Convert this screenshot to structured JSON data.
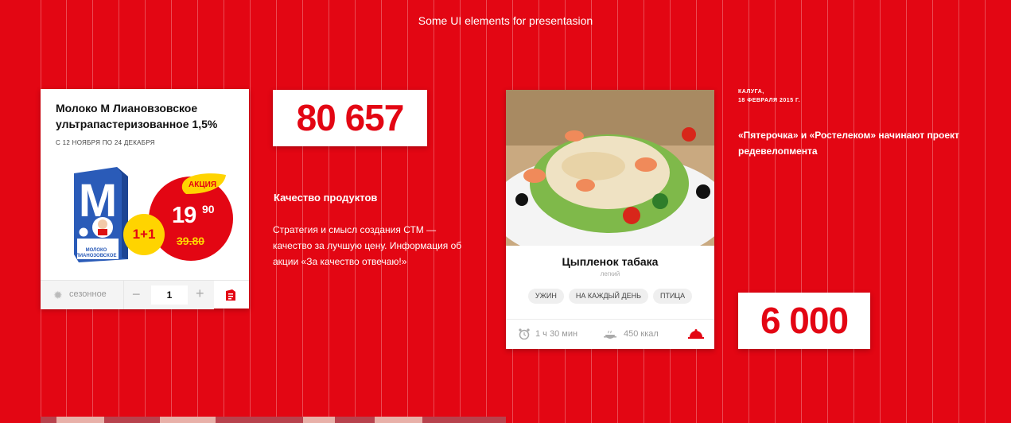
{
  "page": {
    "title": "Some UI elements for presentasion"
  },
  "product_card": {
    "name": "Молоко М Лиановзовское ультрапастеризованное 1,5%",
    "dates": "С 12 НОЯБРЯ ПО 24 ДЕКАБРЯ",
    "pack_brand": "М",
    "pack_label": "МОЛОКО ЛИАНОЗОВСКОЕ",
    "promo_label": "АКЦИЯ",
    "price_main": "19",
    "price_cents": "90",
    "price_old": "39.80",
    "badge": "1+1",
    "season_label": "сезонное",
    "minus": "−",
    "quantity": "1",
    "plus": "+"
  },
  "stat_top": {
    "value": "80 657"
  },
  "quality": {
    "heading": "Качество продуктов",
    "text": "Стратегия и смысл создания СТМ — качество за лучшую цену. Информация об акции «За качество отвечаю!»"
  },
  "recipe_card": {
    "title": "Цыпленок табака",
    "subtitle": "легкий",
    "tags": [
      "УЖИН",
      "НА КАЖДЫЙ ДЕНЬ",
      "ПТИЦА"
    ],
    "time": "1 ч 30 мин",
    "calories": "450 ккал"
  },
  "news": {
    "location": "КАЛУГА,",
    "date": "18 ФЕВРАЛЯ 2015 Г.",
    "headline": "«Пятерочка» и «Ростелеком» начинают проект редевелопмента"
  },
  "stat_bottom": {
    "value": "6 000"
  },
  "colors": {
    "brand_red": "#e30613",
    "promo_yellow": "#ffd400",
    "white": "#ffffff"
  }
}
